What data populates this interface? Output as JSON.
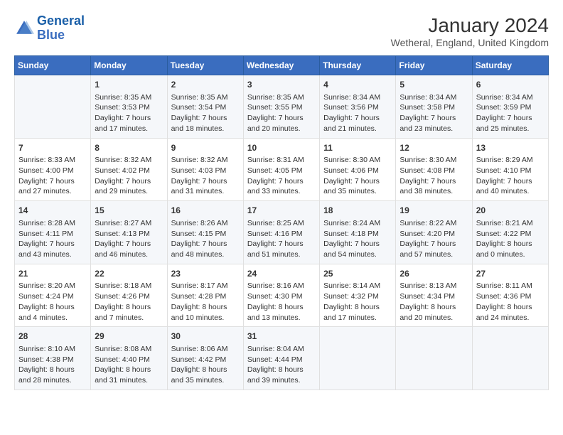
{
  "logo": {
    "line1": "General",
    "line2": "Blue"
  },
  "title": "January 2024",
  "subtitle": "Wetheral, England, United Kingdom",
  "headers": [
    "Sunday",
    "Monday",
    "Tuesday",
    "Wednesday",
    "Thursday",
    "Friday",
    "Saturday"
  ],
  "weeks": [
    [
      {
        "day": "",
        "content": ""
      },
      {
        "day": "1",
        "content": "Sunrise: 8:35 AM\nSunset: 3:53 PM\nDaylight: 7 hours\nand 17 minutes."
      },
      {
        "day": "2",
        "content": "Sunrise: 8:35 AM\nSunset: 3:54 PM\nDaylight: 7 hours\nand 18 minutes."
      },
      {
        "day": "3",
        "content": "Sunrise: 8:35 AM\nSunset: 3:55 PM\nDaylight: 7 hours\nand 20 minutes."
      },
      {
        "day": "4",
        "content": "Sunrise: 8:34 AM\nSunset: 3:56 PM\nDaylight: 7 hours\nand 21 minutes."
      },
      {
        "day": "5",
        "content": "Sunrise: 8:34 AM\nSunset: 3:58 PM\nDaylight: 7 hours\nand 23 minutes."
      },
      {
        "day": "6",
        "content": "Sunrise: 8:34 AM\nSunset: 3:59 PM\nDaylight: 7 hours\nand 25 minutes."
      }
    ],
    [
      {
        "day": "7",
        "content": "Sunrise: 8:33 AM\nSunset: 4:00 PM\nDaylight: 7 hours\nand 27 minutes."
      },
      {
        "day": "8",
        "content": "Sunrise: 8:32 AM\nSunset: 4:02 PM\nDaylight: 7 hours\nand 29 minutes."
      },
      {
        "day": "9",
        "content": "Sunrise: 8:32 AM\nSunset: 4:03 PM\nDaylight: 7 hours\nand 31 minutes."
      },
      {
        "day": "10",
        "content": "Sunrise: 8:31 AM\nSunset: 4:05 PM\nDaylight: 7 hours\nand 33 minutes."
      },
      {
        "day": "11",
        "content": "Sunrise: 8:30 AM\nSunset: 4:06 PM\nDaylight: 7 hours\nand 35 minutes."
      },
      {
        "day": "12",
        "content": "Sunrise: 8:30 AM\nSunset: 4:08 PM\nDaylight: 7 hours\nand 38 minutes."
      },
      {
        "day": "13",
        "content": "Sunrise: 8:29 AM\nSunset: 4:10 PM\nDaylight: 7 hours\nand 40 minutes."
      }
    ],
    [
      {
        "day": "14",
        "content": "Sunrise: 8:28 AM\nSunset: 4:11 PM\nDaylight: 7 hours\nand 43 minutes."
      },
      {
        "day": "15",
        "content": "Sunrise: 8:27 AM\nSunset: 4:13 PM\nDaylight: 7 hours\nand 46 minutes."
      },
      {
        "day": "16",
        "content": "Sunrise: 8:26 AM\nSunset: 4:15 PM\nDaylight: 7 hours\nand 48 minutes."
      },
      {
        "day": "17",
        "content": "Sunrise: 8:25 AM\nSunset: 4:16 PM\nDaylight: 7 hours\nand 51 minutes."
      },
      {
        "day": "18",
        "content": "Sunrise: 8:24 AM\nSunset: 4:18 PM\nDaylight: 7 hours\nand 54 minutes."
      },
      {
        "day": "19",
        "content": "Sunrise: 8:22 AM\nSunset: 4:20 PM\nDaylight: 7 hours\nand 57 minutes."
      },
      {
        "day": "20",
        "content": "Sunrise: 8:21 AM\nSunset: 4:22 PM\nDaylight: 8 hours\nand 0 minutes."
      }
    ],
    [
      {
        "day": "21",
        "content": "Sunrise: 8:20 AM\nSunset: 4:24 PM\nDaylight: 8 hours\nand 4 minutes."
      },
      {
        "day": "22",
        "content": "Sunrise: 8:18 AM\nSunset: 4:26 PM\nDaylight: 8 hours\nand 7 minutes."
      },
      {
        "day": "23",
        "content": "Sunrise: 8:17 AM\nSunset: 4:28 PM\nDaylight: 8 hours\nand 10 minutes."
      },
      {
        "day": "24",
        "content": "Sunrise: 8:16 AM\nSunset: 4:30 PM\nDaylight: 8 hours\nand 13 minutes."
      },
      {
        "day": "25",
        "content": "Sunrise: 8:14 AM\nSunset: 4:32 PM\nDaylight: 8 hours\nand 17 minutes."
      },
      {
        "day": "26",
        "content": "Sunrise: 8:13 AM\nSunset: 4:34 PM\nDaylight: 8 hours\nand 20 minutes."
      },
      {
        "day": "27",
        "content": "Sunrise: 8:11 AM\nSunset: 4:36 PM\nDaylight: 8 hours\nand 24 minutes."
      }
    ],
    [
      {
        "day": "28",
        "content": "Sunrise: 8:10 AM\nSunset: 4:38 PM\nDaylight: 8 hours\nand 28 minutes."
      },
      {
        "day": "29",
        "content": "Sunrise: 8:08 AM\nSunset: 4:40 PM\nDaylight: 8 hours\nand 31 minutes."
      },
      {
        "day": "30",
        "content": "Sunrise: 8:06 AM\nSunset: 4:42 PM\nDaylight: 8 hours\nand 35 minutes."
      },
      {
        "day": "31",
        "content": "Sunrise: 8:04 AM\nSunset: 4:44 PM\nDaylight: 8 hours\nand 39 minutes."
      },
      {
        "day": "",
        "content": ""
      },
      {
        "day": "",
        "content": ""
      },
      {
        "day": "",
        "content": ""
      }
    ]
  ]
}
